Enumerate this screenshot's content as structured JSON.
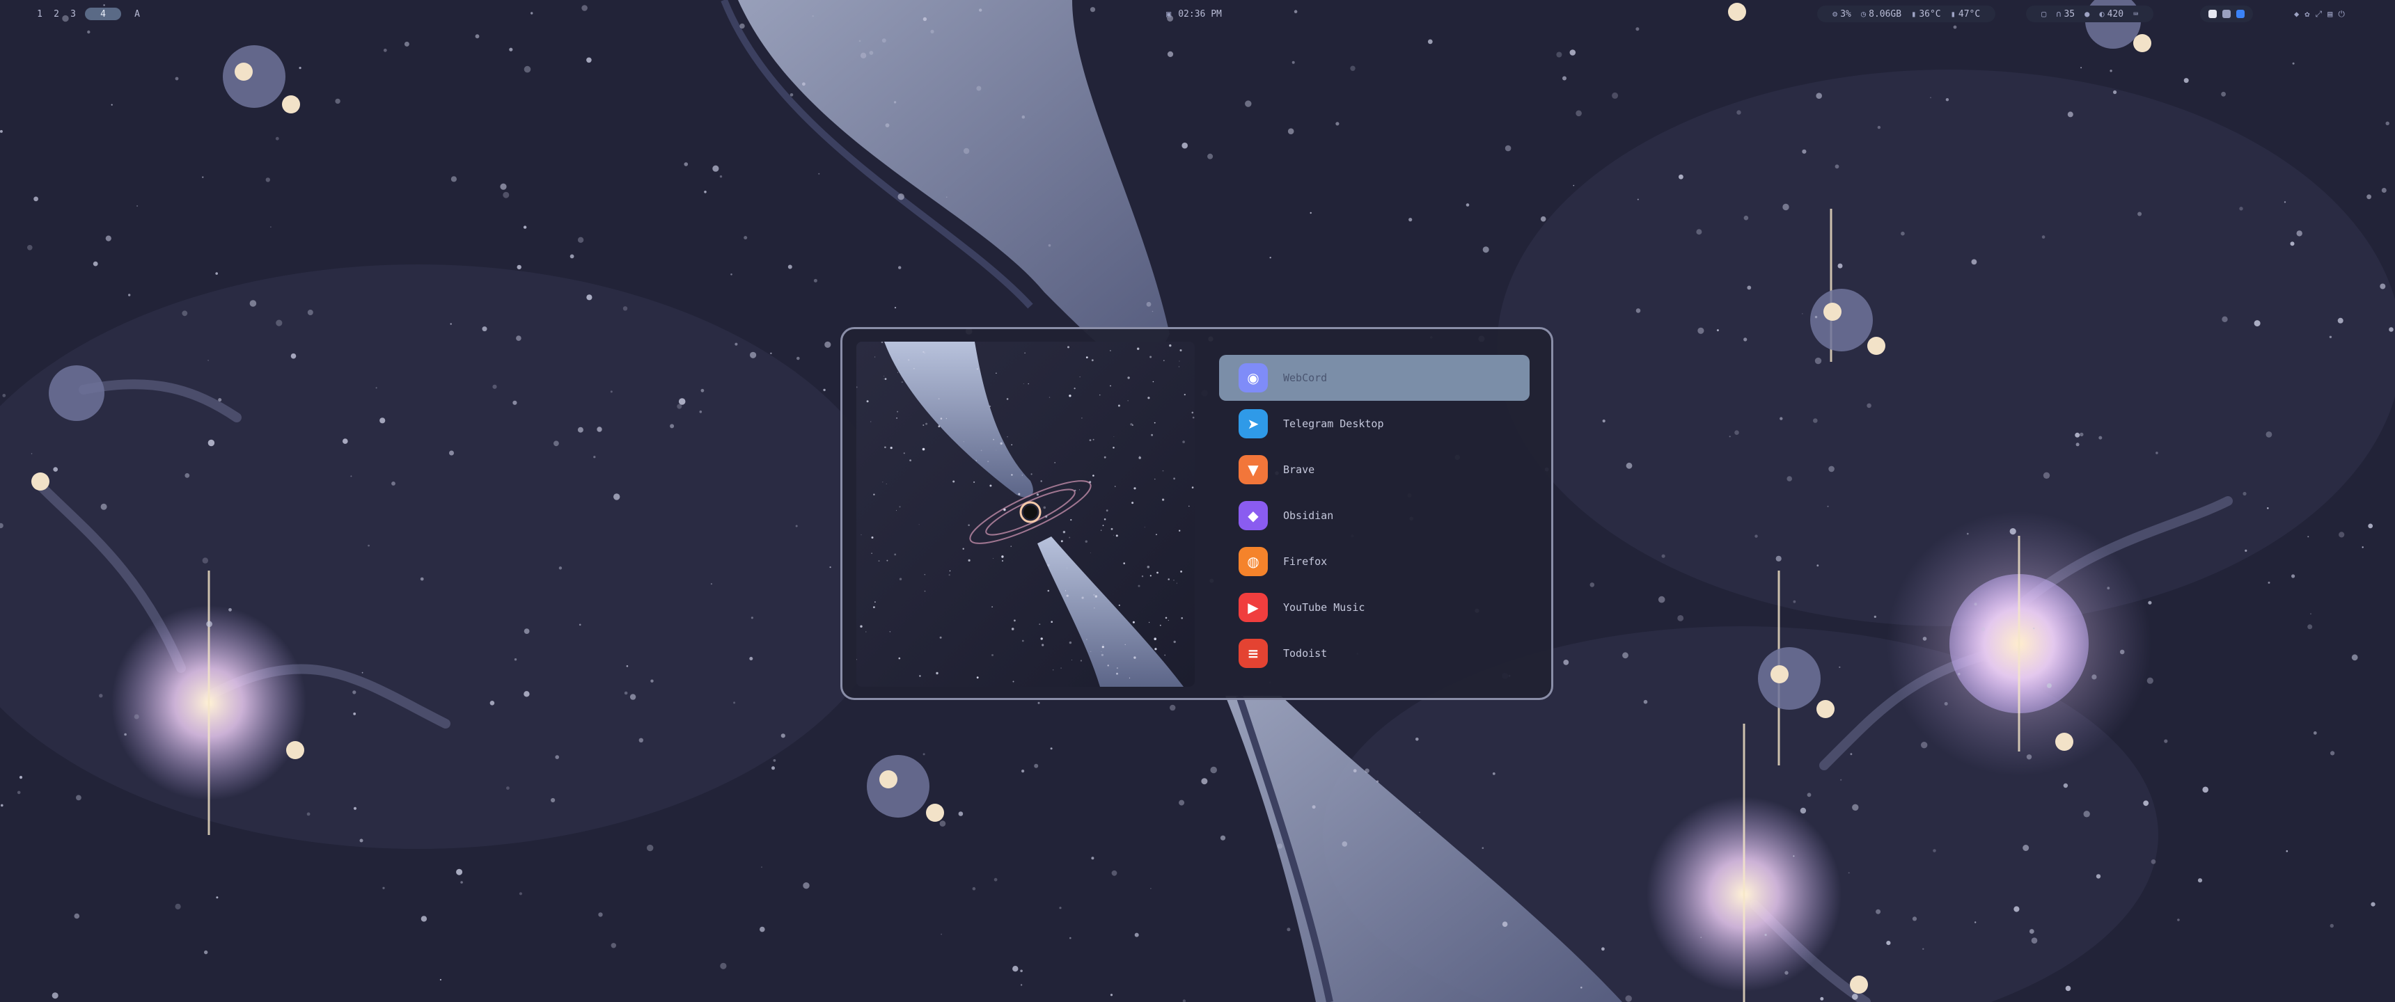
{
  "topbar": {
    "workspaces": [
      {
        "label": "1",
        "active": false
      },
      {
        "label": "2",
        "active": false
      },
      {
        "label": "3",
        "active": false
      },
      {
        "label": "4",
        "active": true
      }
    ],
    "launcher_glyph": "A",
    "clock": "02:36 PM",
    "system": {
      "cpu": "3%",
      "memory": "8.06GB",
      "temp1": "36°C",
      "temp2": "47°C"
    },
    "media": {
      "headphone_volume": "35",
      "brightness": "420"
    }
  },
  "launcher": {
    "selected_index": 0,
    "apps": [
      {
        "label": "WebCord",
        "icon": "discord-icon",
        "color": "#7f8cf8"
      },
      {
        "label": "Telegram Desktop",
        "icon": "telegram-icon",
        "color": "#2f9ae8"
      },
      {
        "label": "Brave",
        "icon": "brave-icon",
        "color": "#f2763a"
      },
      {
        "label": "Obsidian",
        "icon": "obsidian-icon",
        "color": "#8a5cf0"
      },
      {
        "label": "Firefox",
        "icon": "firefox-icon",
        "color": "#f5832b"
      },
      {
        "label": "YouTube Music",
        "icon": "youtube-music-icon",
        "color": "#f03e3e"
      },
      {
        "label": "Todoist",
        "icon": "todoist-icon",
        "color": "#e44332"
      }
    ]
  }
}
